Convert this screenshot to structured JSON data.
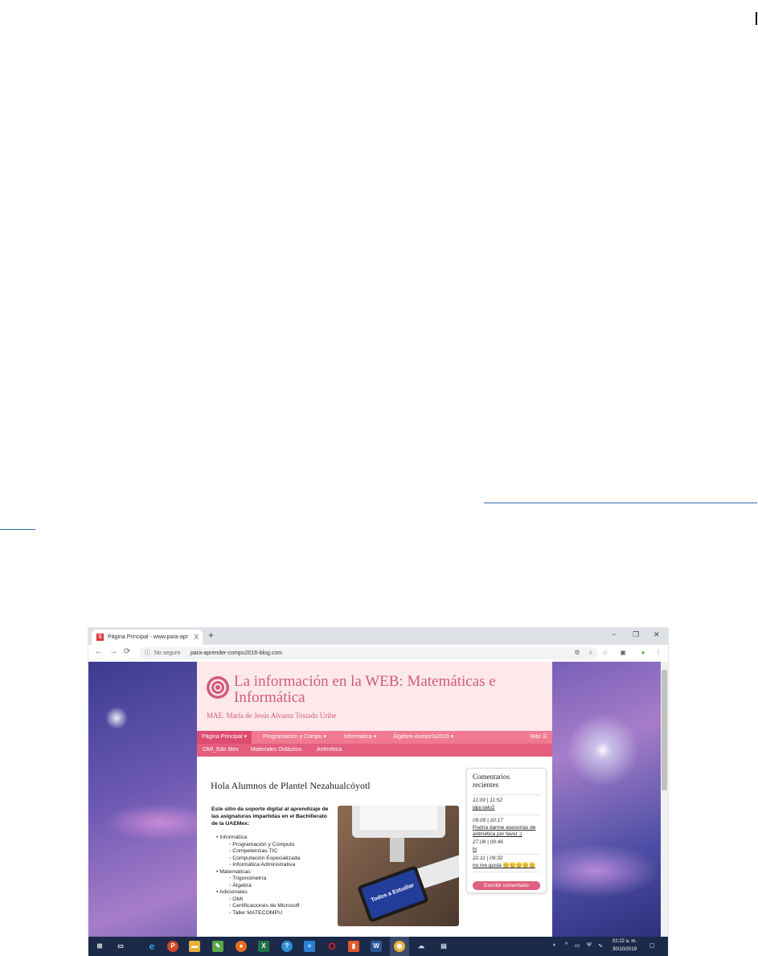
{
  "browser": {
    "tab_title": "Página Principal - www.para-apre",
    "tab_close": "X",
    "new_tab": "+",
    "window_controls": [
      "−",
      "❐",
      "✕"
    ],
    "security_label": "No seguro",
    "url": "para-aprender-compu2016-blog.com"
  },
  "blog": {
    "title": "La información en la WEB: Matemáticas e Informática",
    "subtitle": "MAE. María de Jesús Alvarez Tostado Uribe",
    "menu_primary": [
      "Página Principal ▾",
      "Programación y Cómpu ▾",
      "Informática ▾",
      "Álgebra-Asesoría2019 ▾"
    ],
    "menu_more": "Más ☰",
    "menu_secondary": [
      "OMI_Edo Mex",
      "Materiales Didáctico",
      "Aritmética"
    ]
  },
  "post": {
    "title": "Hola Alumnos de Plantel Nezahualcóyotl",
    "intro": "Este sitio da soporte digital al aprendizaje de las asignaturas impartidas en el Bachillerato de la UAEMex:",
    "list": [
      {
        "level": 1,
        "text": "• Informática:"
      },
      {
        "level": 2,
        "text": "◦ Programación y Cómputo"
      },
      {
        "level": 2,
        "text": "◦ Competencias TIC"
      },
      {
        "level": 2,
        "text": "◦ Computación Especializada"
      },
      {
        "level": 2,
        "text": "◦ Informática Administrativa"
      },
      {
        "level": 1,
        "text": "• Matemáticas"
      },
      {
        "level": 2,
        "text": "◦ Trigonometría"
      },
      {
        "level": 2,
        "text": "◦ Álgebra"
      },
      {
        "level": 1,
        "text": "• Adicionales"
      },
      {
        "level": 2,
        "text": "◦ OMI"
      },
      {
        "level": 2,
        "text": "◦ Certificaciones de Microsoft"
      },
      {
        "level": 2,
        "text": "◦ Taller MATECOMPU"
      }
    ],
    "tablet_text": "Todos a Estudiar"
  },
  "comments": {
    "title": "Comentarios recientes",
    "items": [
      {
        "meta": "11.09 | 11:52",
        "text": "jaja salu2"
      },
      {
        "meta": "09.09 | 20:17",
        "text": "Podría darme asesorías de aritmética por favor :("
      },
      {
        "meta": "27.08 | 09:46",
        "text": "hi"
      },
      {
        "meta": "22.11 | 09:32",
        "text": "no me gusta 😊😊😊😊😊"
      }
    ],
    "button": "Escribir comentario"
  },
  "taskbar": {
    "clock_time": "02:22 a. m.",
    "clock_date": "30/10/2019"
  },
  "colors": {
    "accent": "#e0607f",
    "menu_primary_bg": "#f07a90",
    "menu_secondary_bg": "#e45d7d",
    "header_bg": "#fde8ec",
    "title_color": "#d35a78"
  }
}
